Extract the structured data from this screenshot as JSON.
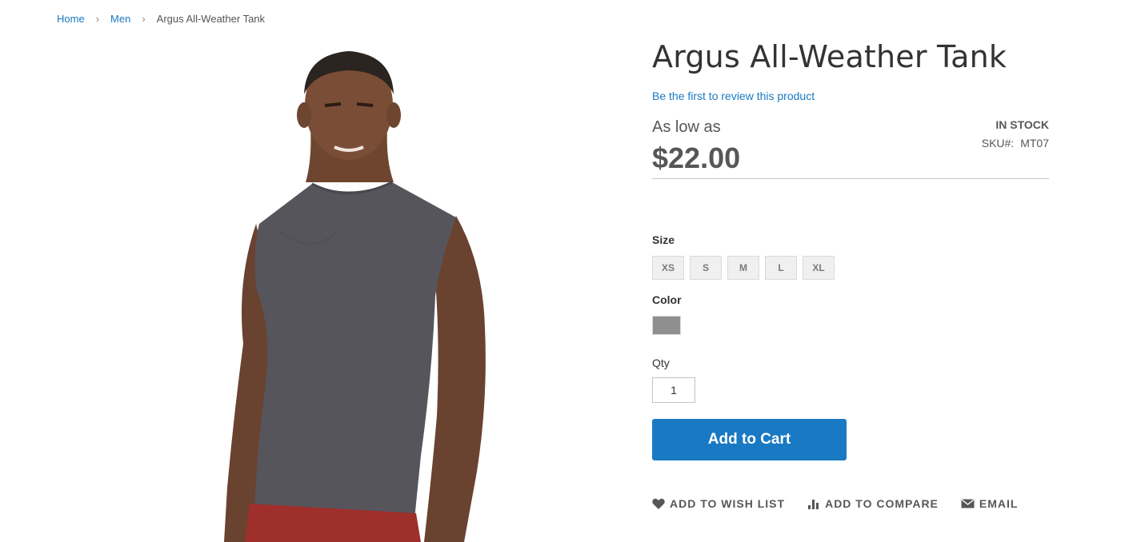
{
  "breadcrumbs": {
    "home": "Home",
    "category": "Men",
    "current": "Argus All-Weather Tank",
    "separator": "›"
  },
  "product": {
    "title": "Argus All-Weather Tank",
    "review_link": "Be the first to review this product",
    "price_label": "As low as",
    "price": "$22.00",
    "stock": "IN STOCK",
    "sku_label": "SKU#:",
    "sku_value": "MT07"
  },
  "options": {
    "size_label": "Size",
    "sizes": [
      "XS",
      "S",
      "M",
      "L",
      "XL"
    ],
    "color_label": "Color",
    "color_value": "#8f8f8f"
  },
  "qty": {
    "label": "Qty",
    "value": "1"
  },
  "cart": {
    "add_label": "Add to Cart"
  },
  "actions": {
    "wishlist": "ADD TO WISH LIST",
    "compare": "ADD TO COMPARE",
    "email": "EMAIL"
  },
  "colors": {
    "accent": "#1979c3",
    "text": "#333333",
    "muted": "#575757"
  }
}
